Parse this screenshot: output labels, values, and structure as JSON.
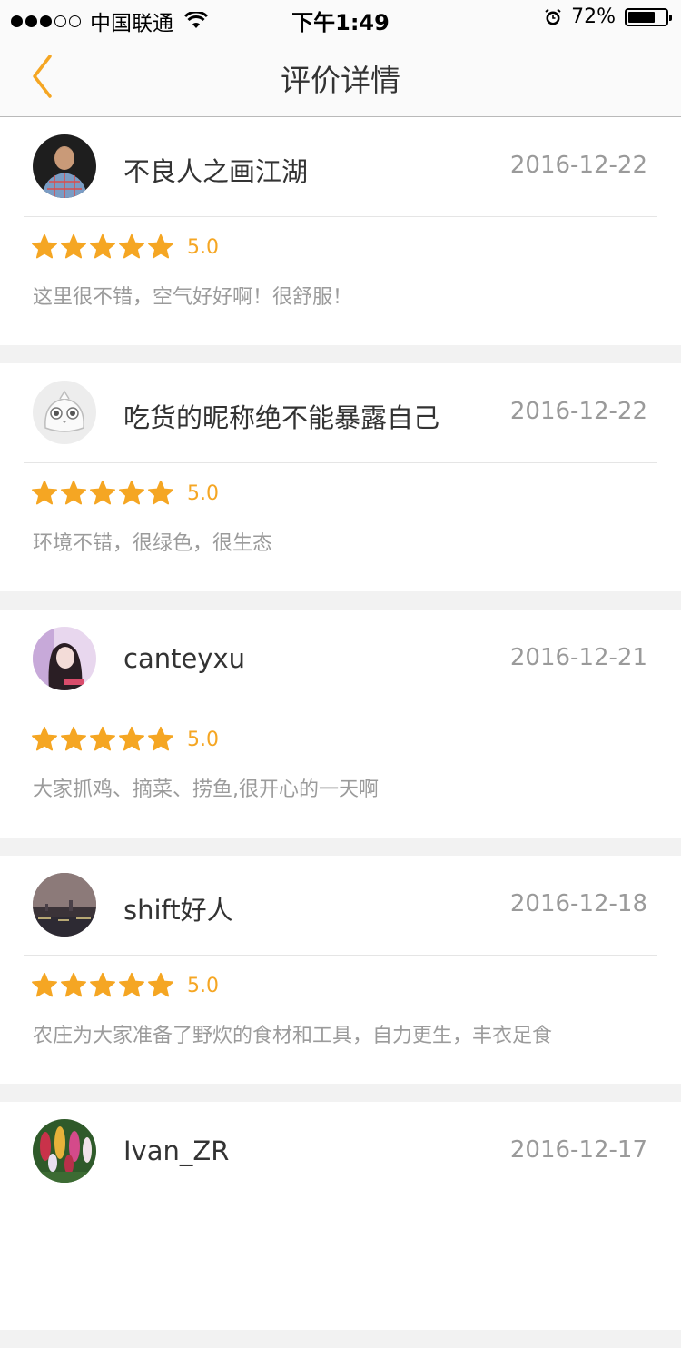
{
  "status_bar": {
    "carrier": "中国联通",
    "time": "下午1:49",
    "battery_percent": "72%",
    "battery_level": 0.72
  },
  "nav": {
    "title": "评价详情",
    "back_icon": "chevron-left-icon",
    "accent_color": "#f5a623"
  },
  "reviews": [
    {
      "name": "不良人之画江湖",
      "date": "2016-12-22",
      "score": "5.0",
      "stars": 5,
      "comment": "这里很不错，空气好好啊！很舒服！"
    },
    {
      "name": "吃货的昵称绝不能暴露自己",
      "date": "2016-12-22",
      "score": "5.0",
      "stars": 5,
      "comment": "环境不错，很绿色，很生态"
    },
    {
      "name": "canteyxu",
      "date": "2016-12-21",
      "score": "5.0",
      "stars": 5,
      "comment": "大家抓鸡、摘菜、捞鱼,很开心的一天啊"
    },
    {
      "name": "shift好人",
      "date": "2016-12-18",
      "score": "5.0",
      "stars": 5,
      "comment": "农庄为大家准备了野炊的食材和工具，自力更生，丰衣足食"
    },
    {
      "name": "Ivan_ZR",
      "date": "2016-12-17",
      "score": "",
      "stars": 0,
      "comment": ""
    }
  ]
}
